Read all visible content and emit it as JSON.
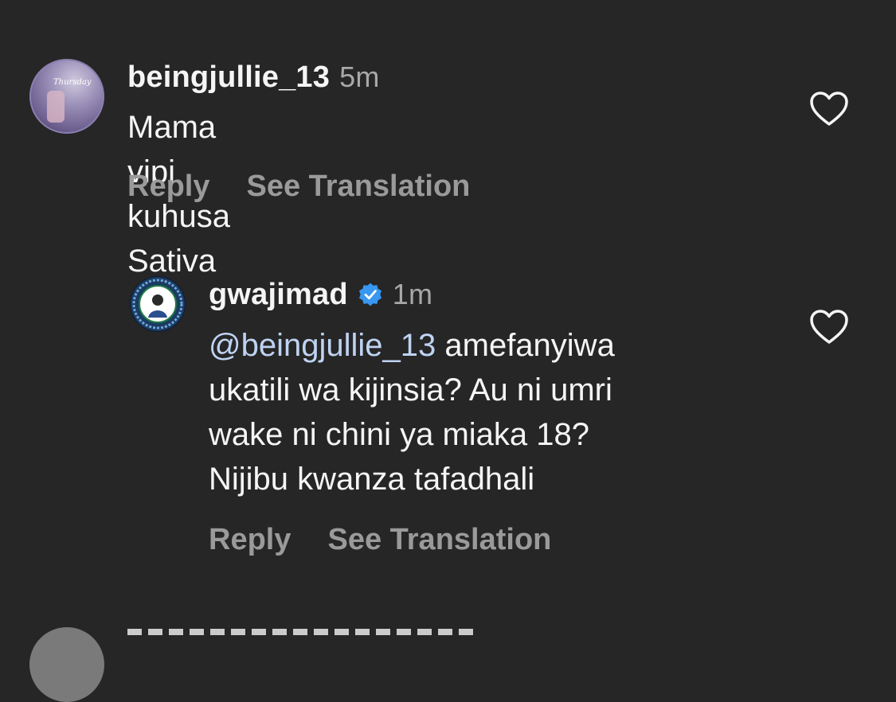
{
  "comments": [
    {
      "username": "beingjullie_13",
      "time": "5m",
      "text": "Mama vipi kuhusa Sativa",
      "reply_label": "Reply",
      "translate_label": "See Translation"
    },
    {
      "username": "gwajimad",
      "time": "1m",
      "mention": "@beingjullie_13",
      "text_lines": [
        " amefanyiwa",
        "ukatili wa kijinsia? Au ni umri",
        "wake ni chini ya miaka 18?",
        "Nijibu kwanza tafadhali"
      ],
      "reply_label": "Reply",
      "translate_label": "See Translation"
    }
  ],
  "icons": {
    "like": "heart-outline-icon",
    "verified": "verified-badge-icon"
  },
  "colors": {
    "background": "#262626",
    "mention": "#bfd3f2",
    "verified": "#3897f0",
    "secondary_text": "#a8a8a8"
  }
}
